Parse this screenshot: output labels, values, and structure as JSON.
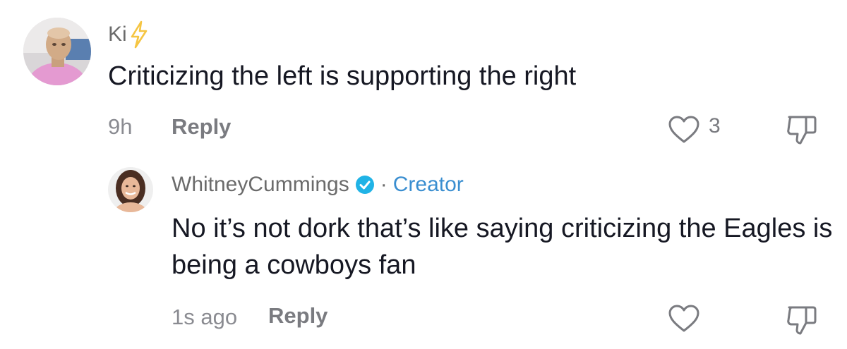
{
  "comments": [
    {
      "username": "Ki",
      "username_badge_icon": "lightning-bolt-icon",
      "text": "Criticizing the left is supporting the right",
      "time": "9h",
      "reply_label": "Reply",
      "like_icon": "heart-outline-icon",
      "like_count": "3",
      "dislike_icon": "thumbs-down-icon"
    }
  ],
  "reply": {
    "username": "WhitneyCummings",
    "verified_icon": "verified-check-icon",
    "separator": "·",
    "role_label": "Creator",
    "text": "No it’s not dork that’s like saying criticizing the Eagles is being a cowboys fan",
    "time": "1s ago",
    "reply_label": "Reply",
    "like_icon": "heart-outline-icon",
    "dislike_icon": "thumbs-down-icon"
  },
  "colors": {
    "text_primary": "#161823",
    "text_secondary": "#7a7b80",
    "creator_accent": "#3a8ed0",
    "verified_badge": "#20b3e6",
    "bolt": "#f5c542"
  }
}
